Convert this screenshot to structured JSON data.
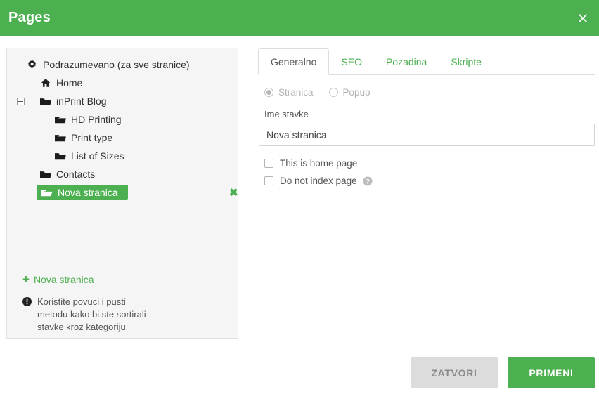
{
  "header": {
    "title": "Pages",
    "close_icon": "close-icon"
  },
  "tree_panel": {
    "items": [
      {
        "label": "Podrazumevano (za sve stranice)",
        "icon": "gear-icon",
        "level": 0,
        "selected": false,
        "toggle": false,
        "deletable": false
      },
      {
        "label": "Home",
        "icon": "home-icon",
        "level": 1,
        "selected": false,
        "toggle": false,
        "deletable": false
      },
      {
        "label": "inPrint Blog",
        "icon": "folder-icon",
        "level": 1,
        "selected": false,
        "toggle": true,
        "toggle_state": "expanded",
        "deletable": false
      },
      {
        "label": "HD Printing",
        "icon": "folder-icon",
        "level": 2,
        "selected": false,
        "toggle": false,
        "deletable": false
      },
      {
        "label": "Print type",
        "icon": "folder-icon",
        "level": 2,
        "selected": false,
        "toggle": false,
        "deletable": false
      },
      {
        "label": "List of Sizes",
        "icon": "folder-icon",
        "level": 2,
        "selected": false,
        "toggle": false,
        "deletable": false
      },
      {
        "label": "Contacts",
        "icon": "folder-icon",
        "level": 1,
        "selected": false,
        "toggle": false,
        "deletable": false
      },
      {
        "label": "Nova stranica",
        "icon": "folder-open-icon",
        "level": 1,
        "selected": true,
        "toggle": false,
        "deletable": true
      }
    ],
    "add_link": {
      "plus": "+",
      "label": "Nova stranica"
    },
    "hint": {
      "icon": "info-icon",
      "text": "Koristite povuci i pusti\nmetodu kako bi ste sortirali\nstavke kroz kategoriju"
    },
    "delete_icon": "✖"
  },
  "tabs": [
    {
      "label": "Generalno",
      "active": true
    },
    {
      "label": "SEO",
      "active": false
    },
    {
      "label": "Pozadina",
      "active": false
    },
    {
      "label": "Skripte",
      "active": false
    }
  ],
  "form": {
    "radios": [
      {
        "label": "Stranica",
        "checked": true,
        "disabled": true
      },
      {
        "label": "Popup",
        "checked": false,
        "disabled": true
      }
    ],
    "name_field": {
      "label": "Ime stavke",
      "value": "Nova stranica",
      "placeholder": ""
    },
    "checkboxes": [
      {
        "label": "This is home page",
        "checked": false,
        "help": false
      },
      {
        "label": "Do not index page",
        "checked": false,
        "help": true
      }
    ],
    "help_icon": "help-icon"
  },
  "footer": {
    "close_label": "ZATVORI",
    "apply_label": "PRIMENI"
  },
  "colors": {
    "accent_green": "#4CAF50",
    "panel_bg": "#f5f5f5",
    "panel_border": "#e0e0e0",
    "disabled_gray": "#dcdcdc",
    "disabled_text": "#8a8a8a"
  }
}
